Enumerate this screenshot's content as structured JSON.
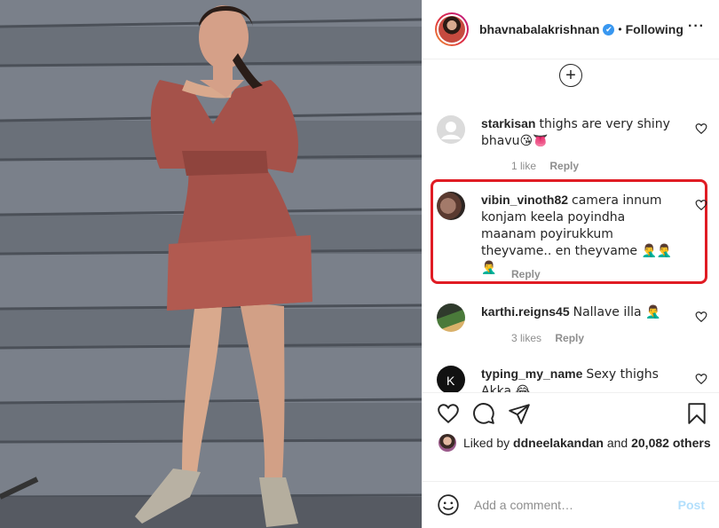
{
  "post": {
    "username": "bhavnabalakrishnan",
    "verified_mark": "✔",
    "separator": "•",
    "follow_status": "Following",
    "more_label": "···"
  },
  "load_more_label": "+",
  "comments": [
    {
      "user": "starkisan",
      "text": "thighs are very shiny bhavu😘👅",
      "likes": "1 like",
      "reply": "Reply",
      "avatar_icon": "default-avatar-icon"
    },
    {
      "user": "vibin_vinoth82",
      "text": "camera innum konjam keela poyindha maanam poyirukkum theyvame.. en theyvame 🤦‍♂️🤦‍♂️🤦‍♂️",
      "likes": "",
      "reply": "Reply",
      "avatar_icon": "user-avatar"
    },
    {
      "user": "karthi.reigns45",
      "text": "Nallave illa 🤦‍♂️",
      "likes": "3 likes",
      "reply": "Reply",
      "avatar_icon": "user-avatar"
    },
    {
      "user": "typing_my_name",
      "text": "Sexy thighs Akka 😂",
      "likes": "",
      "reply": "",
      "avatar_icon": "user-avatar"
    }
  ],
  "likes_summary": {
    "prefix": "Liked by",
    "user": "ddneelakandan",
    "conj": "and",
    "count": "20,082 others"
  },
  "add_comment": {
    "placeholder": "Add a comment…",
    "post_label": "Post"
  },
  "colors": {
    "highlight": "#e01c24",
    "verified": "#3897f0",
    "post_disabled": "#b2dffc"
  },
  "icons": [
    "heart-icon",
    "comment-icon",
    "share-icon",
    "bookmark-icon",
    "emoji-icon",
    "plus-circle-icon"
  ]
}
